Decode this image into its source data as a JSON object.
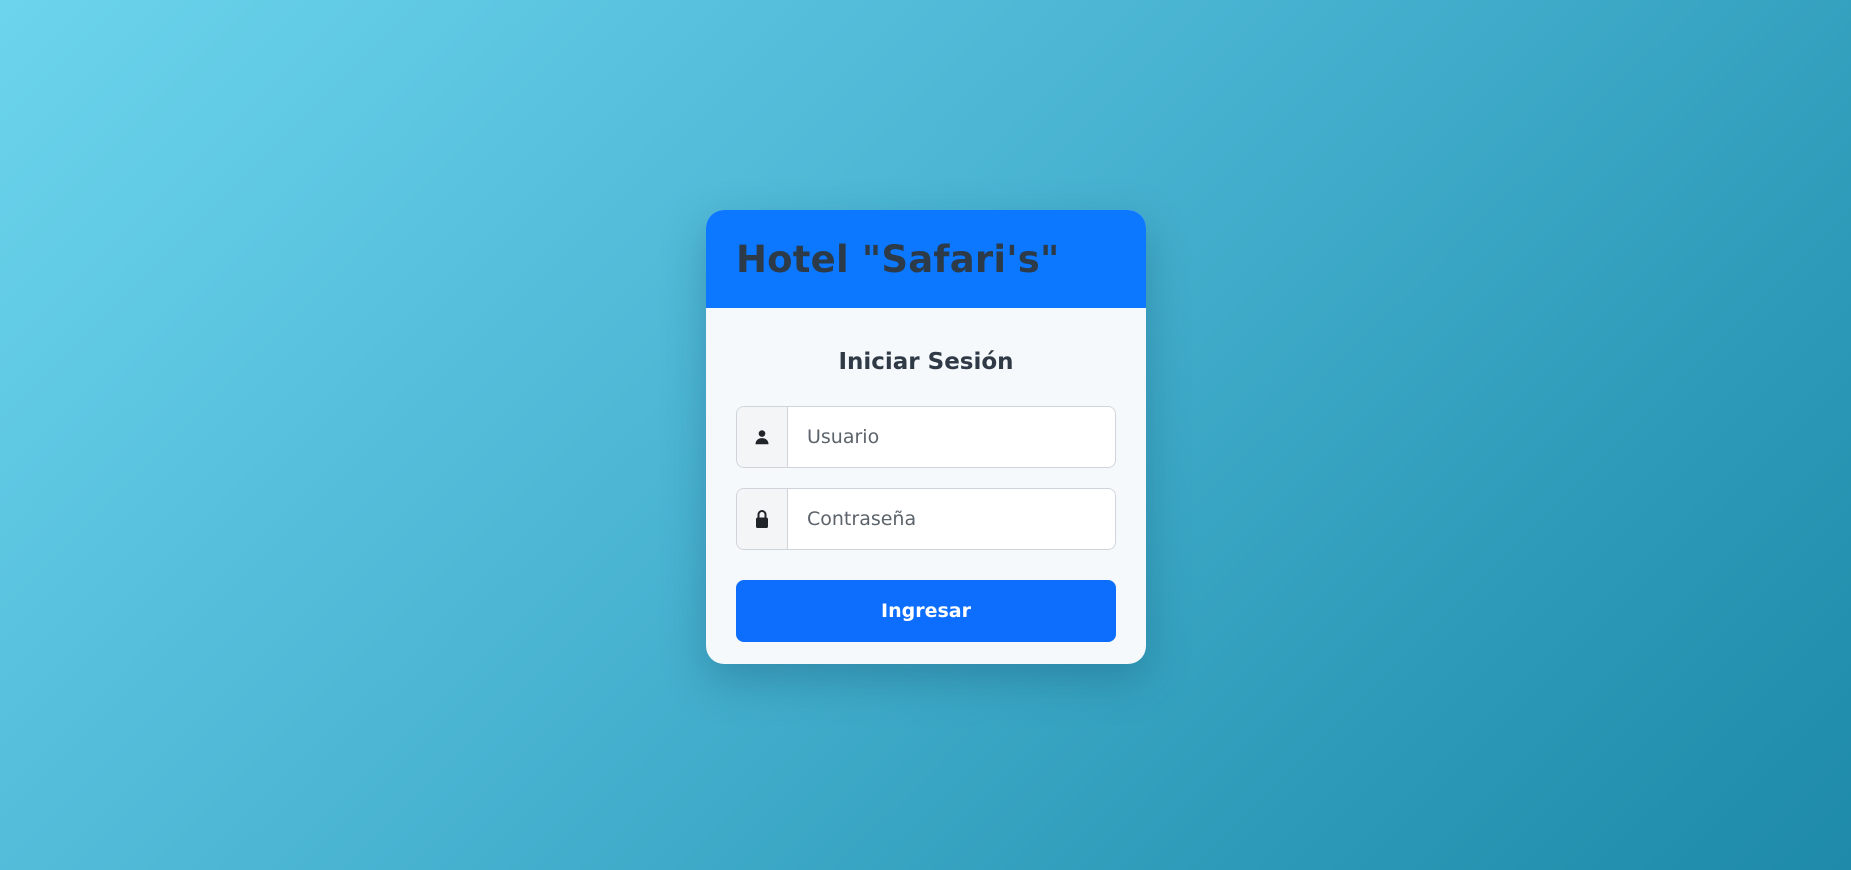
{
  "header": {
    "title": "Hotel \"Safari's\""
  },
  "login": {
    "heading": "Iniciar Sesión",
    "username": {
      "icon": "user-icon",
      "placeholder": "Usuario",
      "value": ""
    },
    "password": {
      "icon": "lock-icon",
      "placeholder": "Contraseña",
      "value": ""
    },
    "submit_label": "Ingresar"
  },
  "colors": {
    "header_bg": "#0b78ff",
    "button_bg": "#0d6efd",
    "title_text": "#2d3a47",
    "card_bg": "#f5f9fc"
  }
}
